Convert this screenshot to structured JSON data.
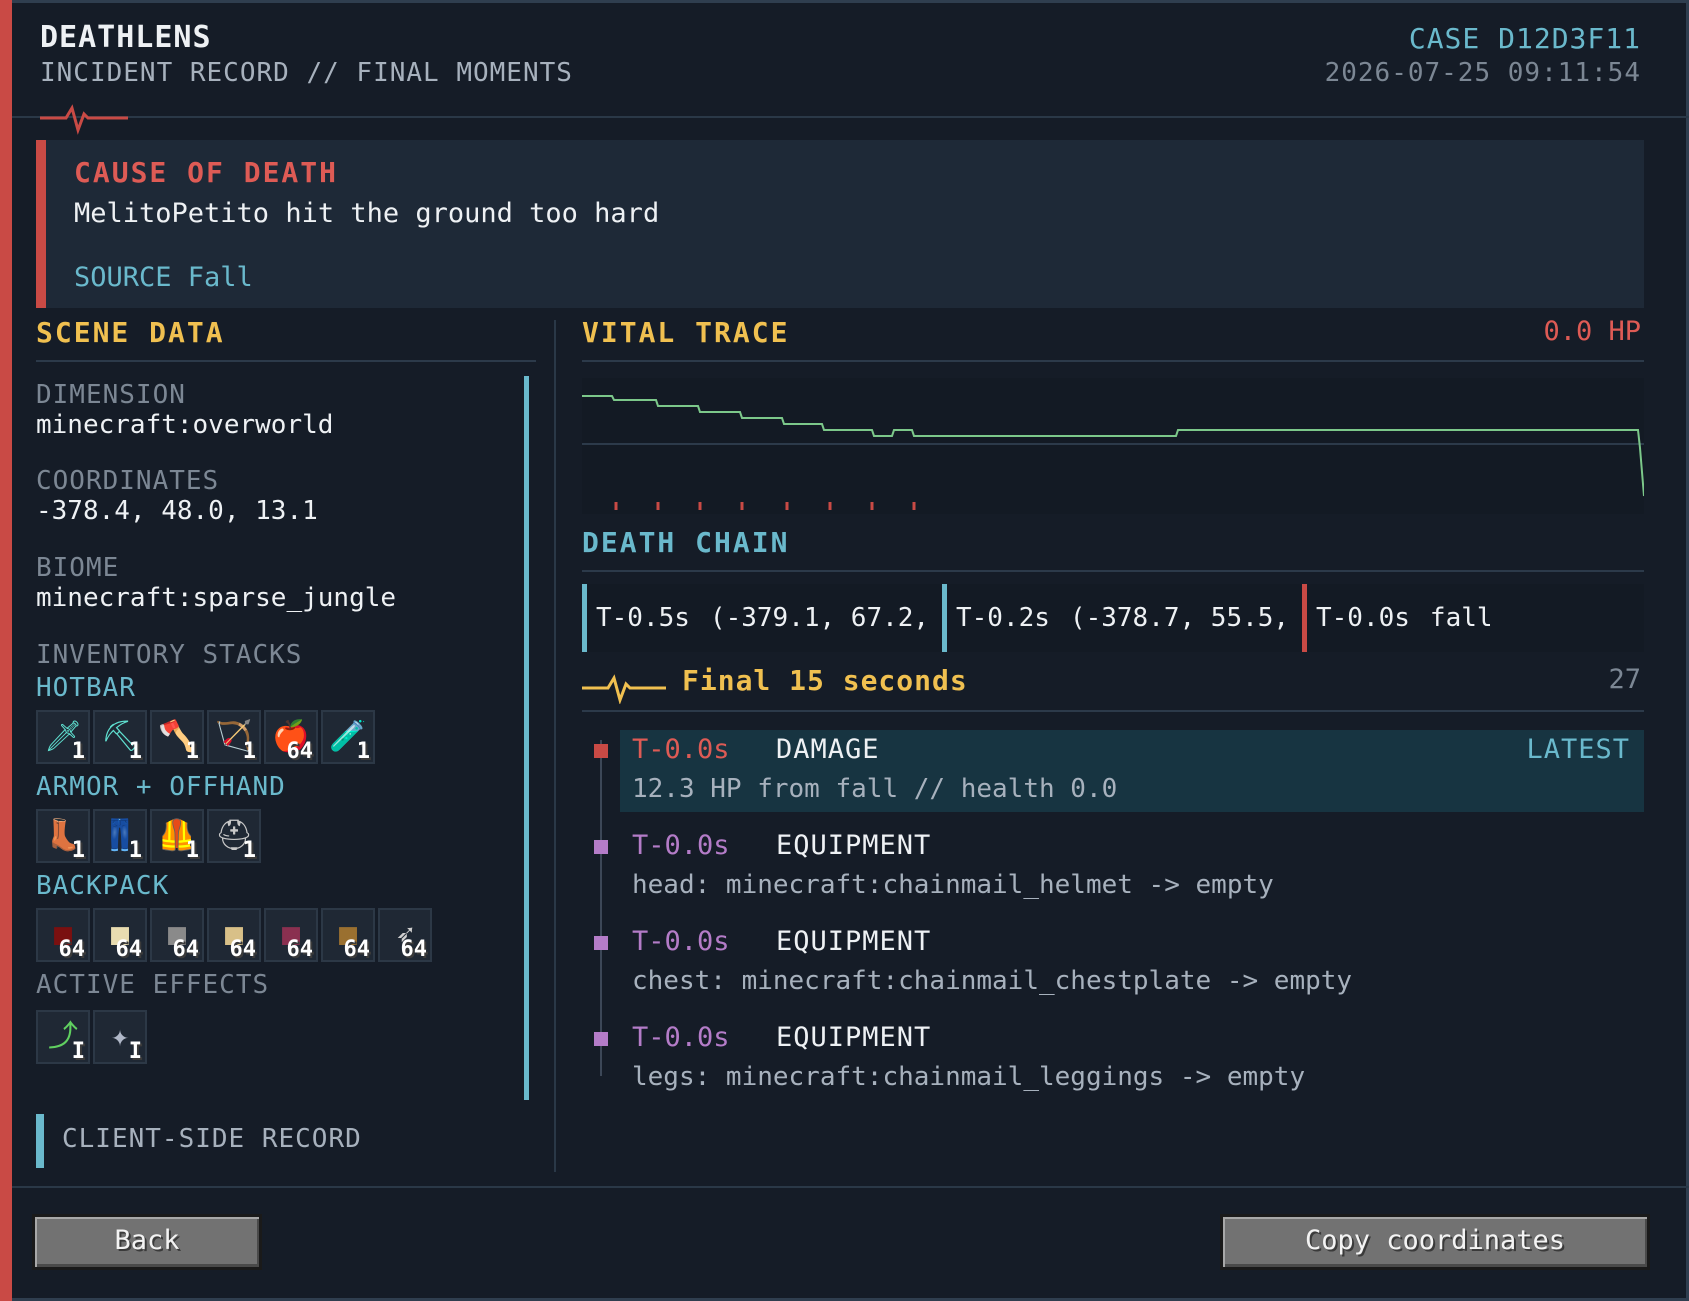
{
  "header": {
    "title": "DEATHLENS",
    "subtitle": "INCIDENT RECORD // FINAL MOMENTS",
    "case_id": "CASE D12D3F11",
    "timestamp": "2026-07-25  09:11:54"
  },
  "cause": {
    "title": "CAUSE OF DEATH",
    "message": "MelitoPetito hit the ground too hard",
    "source": "SOURCE Fall"
  },
  "scene": {
    "title": "SCENE DATA",
    "dimension_label": "DIMENSION",
    "dimension_value": "minecraft:overworld",
    "coordinates_label": "COORDINATES",
    "coordinates_value": "-378.4, 48.0, 13.1",
    "biome_label": "BIOME",
    "biome_value": "minecraft:sparse_jungle",
    "inventory_label": "INVENTORY STACKS",
    "hotbar_label": "HOTBAR",
    "hotbar": [
      {
        "icon": "diamond-sword-icon",
        "glyph": "🗡",
        "color": "#5fe0d0",
        "count": "1"
      },
      {
        "icon": "diamond-pickaxe-icon",
        "glyph": "⛏",
        "color": "#5fe0d0",
        "count": "1"
      },
      {
        "icon": "iron-axe-icon",
        "glyph": "🪓",
        "color": "#cfcfcf",
        "count": "1"
      },
      {
        "icon": "bow-icon",
        "glyph": "🏹",
        "color": "#8a6a3a",
        "count": "1"
      },
      {
        "icon": "apple-icon",
        "glyph": "🍎",
        "color": "#d82020",
        "count": "64"
      },
      {
        "icon": "potion-icon",
        "glyph": "🧪",
        "color": "#f0a040",
        "count": "1"
      }
    ],
    "armor_label": "ARMOR + OFFHAND",
    "armor": [
      {
        "icon": "boots-icon",
        "glyph": "👢",
        "color": "#c8c8c8",
        "count": "1"
      },
      {
        "icon": "leggings-icon",
        "glyph": "👖",
        "color": "#c8c8c8",
        "count": "1"
      },
      {
        "icon": "chestplate-icon",
        "glyph": "🦺",
        "color": "#c8c8c8",
        "count": "1"
      },
      {
        "icon": "helmet-icon",
        "glyph": "⛑",
        "color": "#c8c8c8",
        "count": "1"
      }
    ],
    "backpack_label": "BACKPACK",
    "backpack": [
      {
        "icon": "nether-wart-block-icon",
        "glyph": "■",
        "color": "#7a1010",
        "count": "64"
      },
      {
        "icon": "sandstone-icon",
        "glyph": "■",
        "color": "#e8dcb0",
        "count": "64"
      },
      {
        "icon": "stone-icon",
        "glyph": "■",
        "color": "#8a8a8a",
        "count": "64"
      },
      {
        "icon": "birch-planks-icon",
        "glyph": "■",
        "color": "#d8c088",
        "count": "64"
      },
      {
        "icon": "crimson-block-icon",
        "glyph": "■",
        "color": "#8a3050",
        "count": "64"
      },
      {
        "icon": "oak-log-icon",
        "glyph": "■",
        "color": "#9a7030",
        "count": "64"
      },
      {
        "icon": "arrow-icon",
        "glyph": "➶",
        "color": "#cfcfcf",
        "count": "64"
      }
    ],
    "effects_label": "ACTIVE EFFECTS",
    "effects": [
      {
        "icon": "jump-boost-icon",
        "glyph": "⤴",
        "color": "#60d060",
        "count": "I"
      },
      {
        "icon": "speed-icon",
        "glyph": "✦",
        "color": "#b0b8c8",
        "count": "I"
      }
    ],
    "client_record": "CLIENT-SIDE RECORD"
  },
  "vital": {
    "title": "VITAL TRACE",
    "hp": "0.0 HP"
  },
  "chain": {
    "title": "DEATH CHAIN",
    "items": [
      {
        "time": "T-0.5s",
        "text": "(-379.1, 67.2,",
        "color": "#6ab9cc"
      },
      {
        "time": "T-0.2s",
        "text": "(-378.7, 55.5,",
        "color": "#6ab9cc"
      },
      {
        "time": "T-0.0s",
        "text": "fall",
        "color": "#c94a45"
      }
    ]
  },
  "final": {
    "title": "Final 15 seconds",
    "count": "27",
    "events": [
      {
        "time": "T-0.0s",
        "type": "DAMAGE",
        "desc": "12.3 HP from fall // health 0.0",
        "latest": "LATEST",
        "time_color": "#de5b55",
        "mark_color": "#c94a45"
      },
      {
        "time": "T-0.0s",
        "type": "EQUIPMENT",
        "desc": "head: minecraft:chainmail_helmet -> empty",
        "time_color": "#b47cc8",
        "mark_color": "#b47cc8"
      },
      {
        "time": "T-0.0s",
        "type": "EQUIPMENT",
        "desc": "chest: minecraft:chainmail_chestplate -> empty",
        "time_color": "#b47cc8",
        "mark_color": "#b47cc8"
      },
      {
        "time": "T-0.0s",
        "type": "EQUIPMENT",
        "desc": "legs: minecraft:chainmail_leggings -> empty",
        "time_color": "#b47cc8",
        "mark_color": "#b47cc8"
      }
    ]
  },
  "footer": {
    "back_label": "Back",
    "copy_label": "Copy coordinates"
  },
  "colors": {
    "accent_red": "#c94a45",
    "accent_cyan": "#6ab9cc",
    "accent_gold": "#f0c050",
    "trace_green": "#7cc88a"
  }
}
